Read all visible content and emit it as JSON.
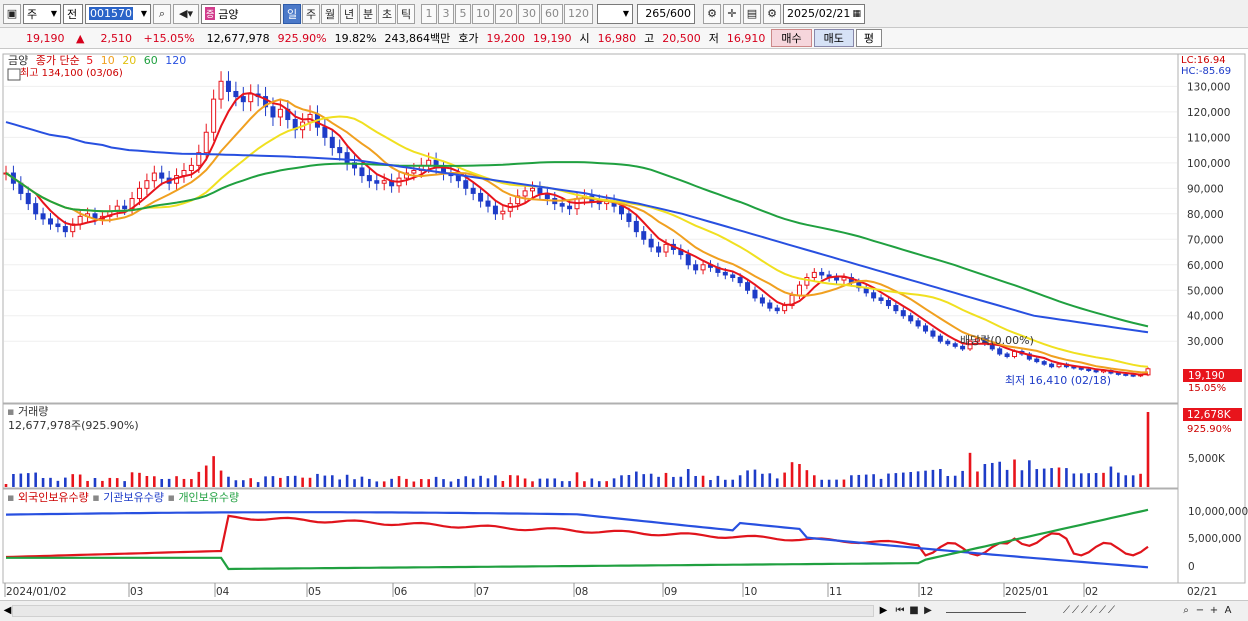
{
  "toolbar": {
    "type_label": "주",
    "prev_label": "전",
    "stock_code": "001570",
    "stock_name": "금양",
    "period_tabs": [
      "일",
      "주",
      "월",
      "년",
      "분",
      "초",
      "틱"
    ],
    "active_period": "일",
    "interval_buttons": [
      "1",
      "3",
      "5",
      "10",
      "20",
      "30",
      "60",
      "120"
    ],
    "data_count": "265",
    "data_max": "/600",
    "date": "2025/02/21"
  },
  "info": {
    "price": "19,190",
    "change_arrow": "▲",
    "change": "2,510",
    "change_pct": "+15.05%",
    "volume": "12,677,978",
    "volume_ratio": "925.90%",
    "turnover": "19.82%",
    "amount": "243,864백만",
    "quote_label": "호가",
    "ask": "19,200",
    "bid": "19,190",
    "open_label": "시",
    "open": "16,980",
    "high_label": "고",
    "high": "20,500",
    "low_label": "저",
    "low": "16,910",
    "buy_label": "매수",
    "sell_label": "매도",
    "avg_label": "평"
  },
  "price_panel": {
    "stock_tag": "금양",
    "ma_title": "종가 단순",
    "ma_periods": [
      "5",
      "10",
      "20",
      "60",
      "120"
    ],
    "ma_colors": [
      "#e8141c",
      "#f0a020",
      "#f0e020",
      "#20a040",
      "#2850e0"
    ],
    "high_marker": "최고 134,100 (03/06)",
    "low_marker": "최저 16,410 (02/18)",
    "dividend_marker": "배당락(0.00%)",
    "lc_label": "LC:16.94",
    "hc_label": "HC:-85.69",
    "y_ticks": [
      "130,000",
      "120,000",
      "110,000",
      "100,000",
      "90,000",
      "80,000",
      "70,000",
      "60,000",
      "50,000",
      "40,000",
      "30,000"
    ],
    "current_price_tag": "19,190",
    "current_pct_tag": "15.05%"
  },
  "volume_panel": {
    "title": "거래량",
    "value_text": "12,677,978주(925.90%)",
    "tag_value": "12,678K",
    "tag_pct": "925.90%",
    "y_tick": "5,000K"
  },
  "holding_panel": {
    "series_labels": [
      "외국인보유수량",
      "기관보유수량",
      "개인보유수량"
    ],
    "series_colors": [
      "#e0141c",
      "#2850e0",
      "#20a040"
    ],
    "y_ticks": [
      "10,000,000",
      "5,000,000",
      "0"
    ]
  },
  "x_axis": {
    "labels": [
      "2024/01/02",
      "03",
      "04",
      "05",
      "06",
      "07",
      "08",
      "09",
      "10",
      "11",
      "12",
      "2025/01",
      "02"
    ],
    "right_label": "02/21"
  },
  "chart_data": {
    "type": "line",
    "note_series": "approximate daily series read from the candlestick chart",
    "price_range": [
      14000,
      138000
    ],
    "close": [
      96000,
      92000,
      88000,
      84000,
      80000,
      78000,
      76000,
      75000,
      73000,
      76000,
      79000,
      80000,
      78000,
      79000,
      81000,
      83000,
      82000,
      86000,
      90000,
      93000,
      96000,
      94000,
      92000,
      95000,
      97000,
      99000,
      104000,
      112000,
      125000,
      132000,
      128000,
      126000,
      124000,
      127000,
      126000,
      122000,
      118000,
      121000,
      117000,
      113000,
      116000,
      119000,
      114000,
      110000,
      106000,
      104000,
      100000,
      98000,
      95000,
      93000,
      92000,
      93000,
      91000,
      94000,
      96000,
      97000,
      99000,
      101000,
      98000,
      96000,
      95000,
      93000,
      90000,
      88000,
      85000,
      83000,
      80000,
      81000,
      84000,
      87000,
      89000,
      90000,
      88000,
      86000,
      84000,
      83000,
      82000,
      86000,
      87000,
      85000,
      84000,
      85000,
      83000,
      80000,
      77000,
      73000,
      70000,
      67000,
      65000,
      68000,
      66000,
      64000,
      60000,
      58000,
      60000,
      59000,
      57000,
      56000,
      55000,
      53000,
      50000,
      47000,
      45000,
      43000,
      42000,
      44000,
      48000,
      52000,
      55000,
      57000,
      56000,
      55000,
      54000,
      55000,
      53000,
      51000,
      49000,
      47000,
      46000,
      44000,
      42000,
      40000,
      38000,
      36000,
      34000,
      32000,
      30000,
      29000,
      28000,
      27000,
      30000,
      31000,
      29000,
      27000,
      25000,
      24000,
      26000,
      25000,
      23000,
      22000,
      21000,
      20000,
      21000,
      20000,
      19500,
      19000,
      18500,
      18000,
      18500,
      17500,
      17000,
      16700,
      16410,
      16800,
      19190
    ],
    "ma120": [
      116000,
      115000,
      114000,
      113000,
      112000,
      111000,
      110500,
      110000,
      109000,
      108000,
      107500,
      107000,
      106000,
      105500,
      105000,
      104800,
      104500,
      104200,
      104000,
      103800,
      103600,
      103500,
      103500,
      103400,
      103300,
      103200,
      103100,
      103000,
      102900,
      102800,
      102700,
      102600,
      102500,
      102300,
      102200,
      102000,
      101800,
      101600,
      101400,
      101200,
      101000,
      100500,
      100000,
      99500,
      99000,
      98500,
      98000,
      97500,
      97000,
      96500,
      96000,
      95500,
      95000,
      94500,
      94000,
      93500,
      93000,
      92500,
      92000,
      91500,
      91000,
      90500,
      90000,
      89500,
      89000,
      88500,
      88000,
      87300,
      86600,
      86000,
      85300,
      84600,
      84000,
      83200,
      82400,
      81600,
      80800,
      80000,
      79000,
      78000,
      77000,
      76000,
      75000,
      74000,
      73000,
      72000,
      71000,
      70000,
      69000,
      68000,
      67000,
      66000,
      65000,
      64000,
      63000,
      62000,
      61000,
      60000,
      59000,
      58000,
      57000,
      56000,
      55000,
      54000,
      53000,
      52000,
      51000,
      50000,
      49000,
      48000,
      47000,
      46000,
      45000,
      44000,
      43000,
      42000,
      41000,
      40000,
      39500,
      39000,
      38500,
      38000,
      37500,
      37000,
      36500,
      36000,
      35500,
      35000,
      34500,
      34000,
      33500
    ]
  }
}
